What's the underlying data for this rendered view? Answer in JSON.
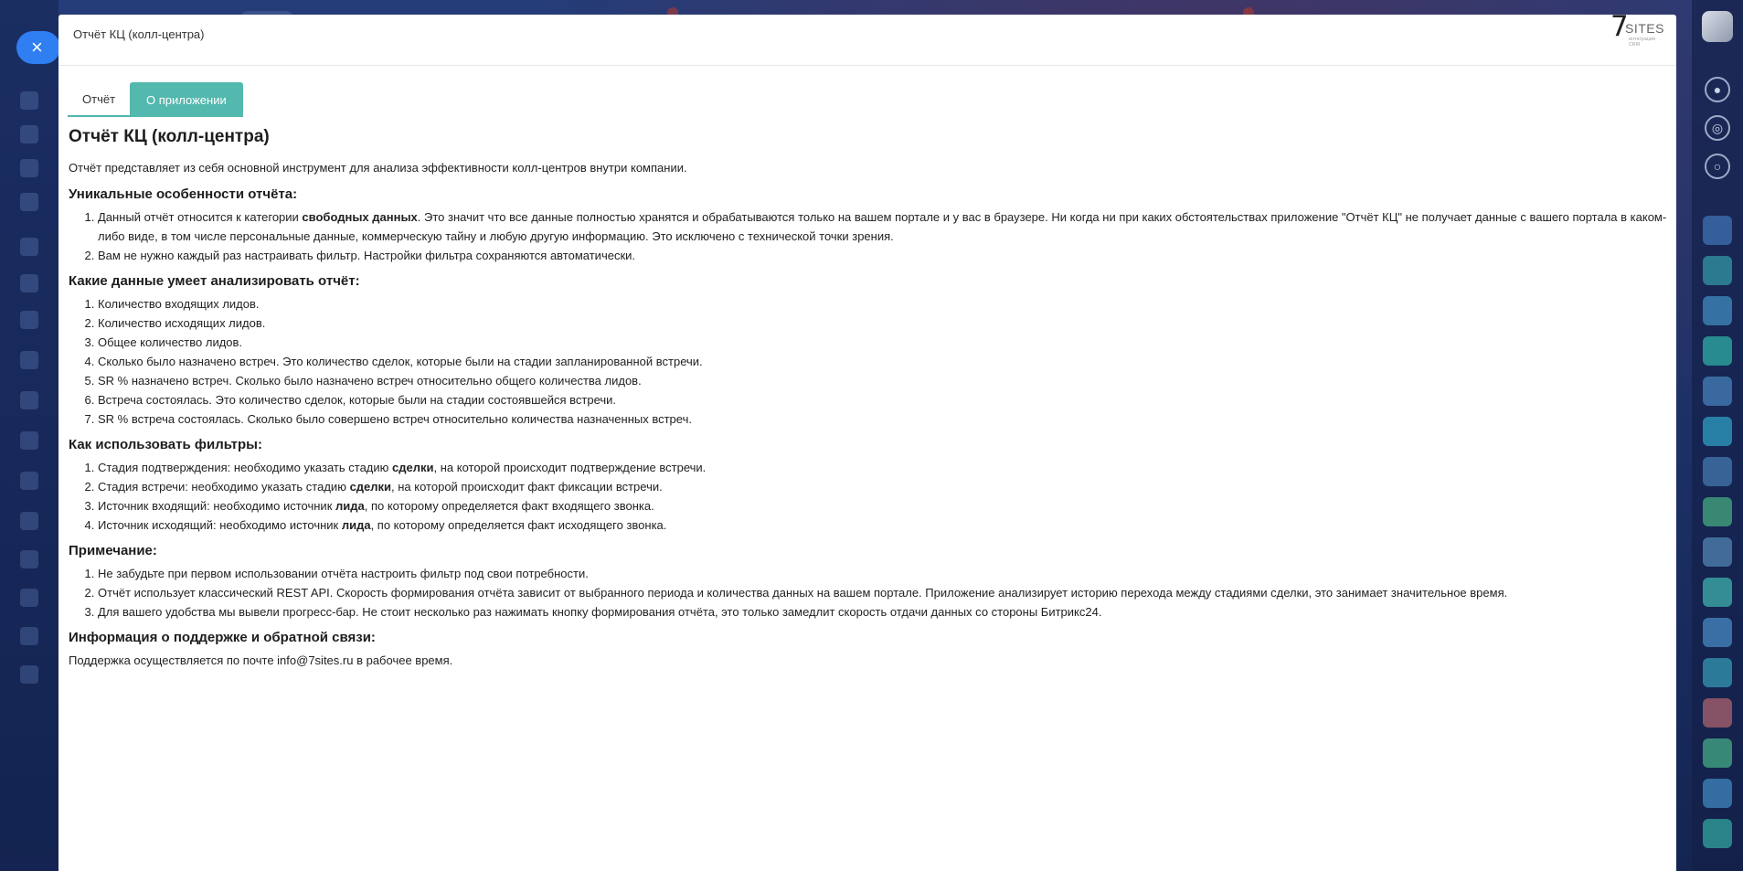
{
  "modal": {
    "title": "Отчёт КЦ (колл-центра)",
    "logo": {
      "digit": "7",
      "text": "SITES",
      "subtext": "интеграция CRM"
    }
  },
  "tabs": [
    {
      "label": "Отчёт",
      "active": false
    },
    {
      "label": "О приложении",
      "active": true
    }
  ],
  "content": {
    "heading": "Отчёт КЦ (колл-центра)",
    "intro": "Отчёт представляет из себя основной инструмент для анализа эффективности колл-центров внутри компании.",
    "features": {
      "heading": "Уникальные особенности отчёта:",
      "item1_pre": "Данный отчёт относится к категории ",
      "item1_bold": "свободных данных",
      "item1_post": ". Это значит что все данные полностью хранятся и обрабатываются только на вашем портале и у вас в браузере. Ни когда ни при каких обстоятельствах приложение \"Отчёт КЦ\" не получает данные с вашего портала в каком-либо виде, в том числе персональные данные, коммерческую тайну и любую другую информацию. Это исключено с технической точки зрения.",
      "item2": "Вам не нужно каждый раз настраивать фильтр. Настройки фильтра сохраняются автоматически."
    },
    "data_section": {
      "heading": "Какие данные умеет анализировать отчёт:",
      "items": [
        "Количество входящих лидов.",
        "Количество исходящих лидов.",
        "Общее количество лидов.",
        "Сколько было назначено встреч. Это количество сделок, которые были на стадии запланированной встречи.",
        "SR % назначено встреч. Сколько было назначено встреч относительно общего количества лидов.",
        "Встреча состоялась. Это количество сделок, которые были на стадии состоявшейся встречи.",
        "SR % встреча состоялась. Сколько было совершено встреч относительно количества назначенных встреч."
      ]
    },
    "filters": {
      "heading": "Как использовать фильтры:",
      "items": [
        {
          "pre": "Стадия подтверждения: необходимо указать стадию ",
          "bold": "сделки",
          "post": ", на которой происходит подтверждение встречи."
        },
        {
          "pre": "Стадия встречи: необходимо указать стадию ",
          "bold": "сделки",
          "post": ", на которой происходит факт фиксации встречи."
        },
        {
          "pre": "Источник входящий: необходимо источник ",
          "bold": "лида",
          "post": ", по которому определяется факт входящего звонка."
        },
        {
          "pre": "Источник исходящий: необходимо источник ",
          "bold": "лида",
          "post": ", по которому определяется факт исходящего звонка."
        }
      ]
    },
    "notes": {
      "heading": "Примечание:",
      "items": [
        "Не забудьте при первом использовании отчёта настроить фильтр под свои потребности.",
        "Отчёт использует классический REST API. Скорость формирования отчёта зависит от выбранного периода и количества данных на вашем портале. Приложение анализирует историю перехода между стадиями сделки, это занимает значительное время.",
        "Для вашего удобства мы вывели прогресс-бар. Не стоит несколько раз нажимать кнопку формирования отчёта, это только замедлит скорость отдачи данных со стороны Битрикс24."
      ]
    },
    "support": {
      "heading": "Информация о поддержке и обратной связи:",
      "text": "Поддержка осуществляется по почте info@7sites.ru в рабочее время."
    }
  },
  "overlay": {
    "close_icon": "×",
    "right_icons": [
      "bell-icon",
      "target-icon",
      "chat-icon"
    ]
  },
  "colors": {
    "accent_tab": "#53b8ad",
    "close_button": "#2f7ef2",
    "background": "#1c2f64"
  }
}
